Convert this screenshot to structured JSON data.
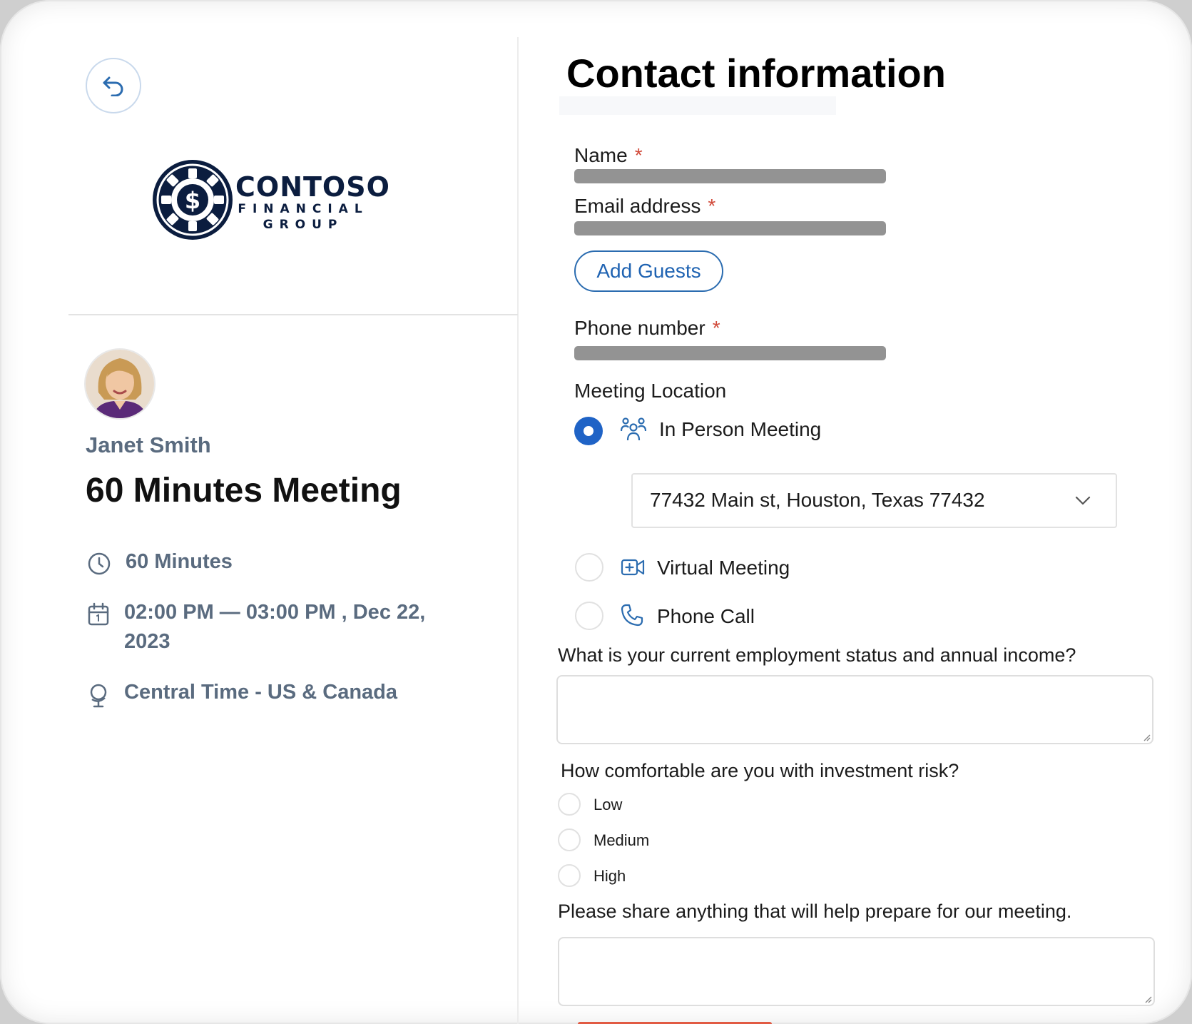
{
  "left_panel": {
    "logo": {
      "title": "CONTOSO",
      "subtitle_1": "FINANCIAL",
      "subtitle_2": "GROUP"
    },
    "host_name": "Janet Smith",
    "meeting_title": "60 Minutes Meeting",
    "duration": "60 Minutes",
    "datetime_line1": "02:00 PM — 03:00 PM , Dec 22,",
    "datetime_line2": "2023",
    "timezone": "Central Time - US & Canada"
  },
  "form": {
    "title": "Contact information",
    "name_label": "Name",
    "email_label": "Email address",
    "required_mark": "*",
    "add_guests_label": "Add Guests",
    "phone_label": "Phone number",
    "location_label": "Meeting Location",
    "locations": [
      {
        "label": "In Person Meeting",
        "icon": "people-icon",
        "selected": true
      },
      {
        "label": "Virtual Meeting",
        "icon": "video-icon",
        "selected": false
      },
      {
        "label": "Phone Call",
        "icon": "phone-icon",
        "selected": false
      }
    ],
    "address_value": "77432 Main st, Houston, Texas 77432",
    "question_employment": "What is your current employment status and annual income?",
    "question_risk": "How comfortable are you with investment risk?",
    "risk_options": [
      "Low",
      "Medium",
      "High"
    ],
    "question_prepare": "Please share anything that will help prepare for our meeting."
  },
  "colors": {
    "accent": "#1f63c6",
    "required": "#d14a3a",
    "muted_text": "#5a6b7f",
    "brand_navy": "#0b1d3f"
  }
}
